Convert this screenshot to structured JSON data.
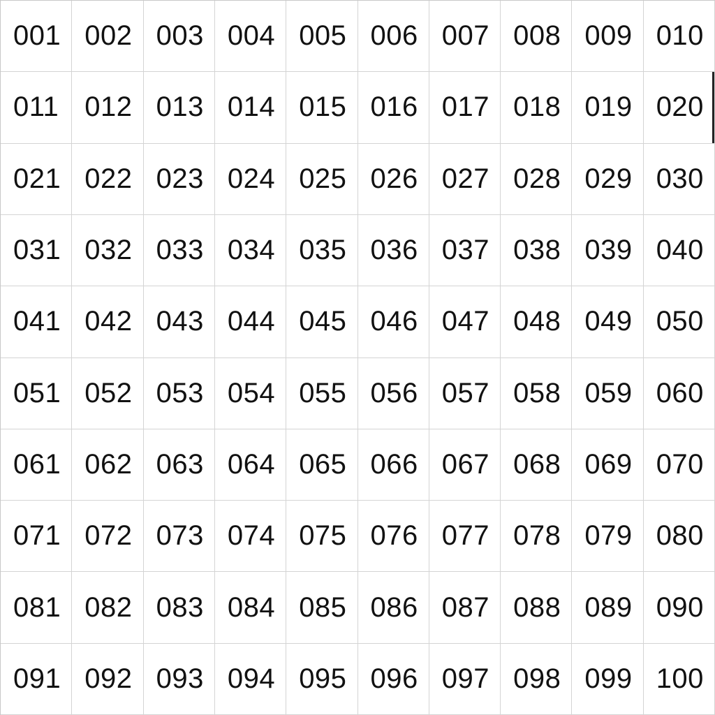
{
  "sheet": {
    "cells": [
      "001",
      "002",
      "003",
      "004",
      "005",
      "006",
      "007",
      "008",
      "009",
      "010",
      "011",
      "012",
      "013",
      "014",
      "015",
      "016",
      "017",
      "018",
      "019",
      "020",
      "021",
      "022",
      "023",
      "024",
      "025",
      "026",
      "027",
      "028",
      "029",
      "030",
      "031",
      "032",
      "033",
      "034",
      "035",
      "036",
      "037",
      "038",
      "039",
      "040",
      "041",
      "042",
      "043",
      "044",
      "045",
      "046",
      "047",
      "048",
      "049",
      "050",
      "051",
      "052",
      "053",
      "054",
      "055",
      "056",
      "057",
      "058",
      "059",
      "060",
      "061",
      "062",
      "063",
      "064",
      "065",
      "066",
      "067",
      "068",
      "069",
      "070",
      "071",
      "072",
      "073",
      "074",
      "075",
      "076",
      "077",
      "078",
      "079",
      "080",
      "081",
      "082",
      "083",
      "084",
      "085",
      "086",
      "087",
      "088",
      "089",
      "090",
      "091",
      "092",
      "093",
      "094",
      "095",
      "096",
      "097",
      "098",
      "099",
      "100"
    ],
    "selected_cell": "020",
    "colors": {
      "grid_line": "#d4d4d4",
      "text": "#111111",
      "selection_edge": "#222222"
    }
  }
}
